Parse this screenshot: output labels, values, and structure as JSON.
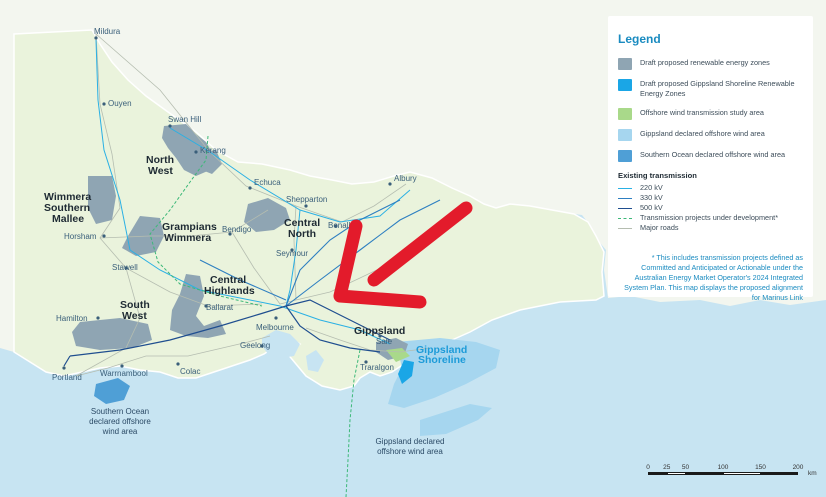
{
  "colors": {
    "sea": "#c7e4f2",
    "land": "#eef5e4",
    "state_border_land": "#f3f6ef",
    "renewable_zone": "#8fa5b3",
    "gippsland_shoreline": "#1aa6e6",
    "offshore_study": "#a9d98a",
    "gippsland_offshore": "#a6d6ef",
    "southern_ocean_offshore": "#4f9fd6",
    "line_220": "#2ab0e4",
    "line_330": "#2e7fc1",
    "line_500": "#1f4e8f",
    "tx_dev": "#3cb878",
    "roads": "#b5bdb0",
    "arrow": "#e31b2b"
  },
  "legend": {
    "title": "Legend",
    "items": [
      {
        "label": "Draft proposed renewable energy zones",
        "color": "#8fa5b3"
      },
      {
        "label": "Draft proposed Gippsland Shoreline Renewable Energy Zones",
        "color": "#1aa6e6"
      },
      {
        "label": "Offshore wind transmission study area",
        "color": "#a9d98a"
      },
      {
        "label": "Gippsland declared offshore wind area",
        "color": "#a6d6ef"
      },
      {
        "label": "Southern Ocean declared offshore wind area",
        "color": "#4f9fd6"
      }
    ],
    "transmission_title": "Existing transmission",
    "lines": [
      {
        "label": "220 kV",
        "color": "#2ab0e4",
        "style": "solid"
      },
      {
        "label": "330 kV",
        "color": "#2e7fc1",
        "style": "solid"
      },
      {
        "label": "500 kV",
        "color": "#1f4e8f",
        "style": "solid"
      },
      {
        "label": "Transmission projects under development*",
        "color": "#3cb878",
        "style": "dashed"
      },
      {
        "label": "Major roads",
        "color": "#b5bdb0",
        "style": "solid"
      }
    ],
    "note": "* This includes transmission projects defined as Committed and Anticipated or Actionable under the Australian Energy Market Operator's 2024 Integrated System Plan. This map displays the proposed alignment for Marinus Link"
  },
  "towns": {
    "mildura": "Mildura",
    "ouyen": "Ouyen",
    "swan_hill": "Swan Hill",
    "kerang": "Kerang",
    "echuca": "Echuca",
    "shepparton": "Shepparton",
    "albury": "Albury",
    "benalla": "Benalla",
    "bendigo": "Bendigo",
    "horsham": "Horsham",
    "stawell": "Stawell",
    "seymour": "Seymour",
    "ballarat": "Ballarat",
    "melbourne": "Melbourne",
    "geelong": "Geelong",
    "hamilton": "Hamilton",
    "portland": "Portland",
    "warrnambool": "Warrnambool",
    "colac": "Colac",
    "sale": "Sale",
    "traralgon": "Traralgon"
  },
  "zones": {
    "north_west_1": "North",
    "north_west_2": "West",
    "wimmera_mallee_1": "Wimmera",
    "wimmera_mallee_2": "Southern",
    "wimmera_mallee_3": "Mallee",
    "grampians_1": "Grampians",
    "grampians_2": "Wimmera",
    "central_north_1": "Central",
    "central_north_2": "North",
    "central_highlands_1": "Central",
    "central_highlands_2": "Highlands",
    "south_west_1": "South",
    "south_west_2": "West",
    "gippsland": "Gippsland",
    "gippsland_shoreline_1": "Gippsland",
    "gippsland_shoreline_2": "Shoreline"
  },
  "offshore": {
    "southern_ocean_1": "Southern Ocean",
    "southern_ocean_2": "declared offshore",
    "southern_ocean_3": "wind area",
    "gippsland_1": "Gippsland declared",
    "gippsland_2": "offshore wind area"
  },
  "scale": {
    "ticks": [
      "0",
      "25",
      "50",
      "100",
      "150",
      "200"
    ],
    "tick_km": [
      0,
      25,
      50,
      100,
      150,
      200
    ],
    "unit": "km"
  }
}
